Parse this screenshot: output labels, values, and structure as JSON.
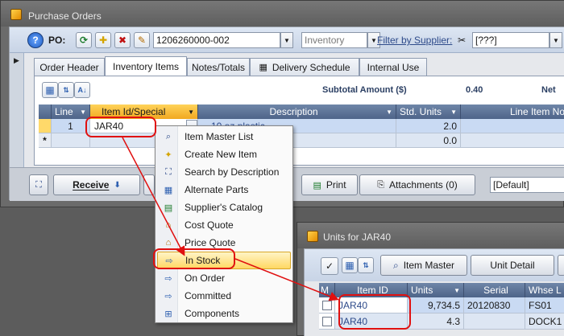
{
  "po_window": {
    "title": "Purchase Orders",
    "po_label": "PO:",
    "po_number": "1206260000-002",
    "type_value": "Inventory",
    "filter_label": "Filter by Supplier:",
    "filter_value": "[???]",
    "help_glyph": "?"
  },
  "tabs": [
    {
      "label": "Order Header"
    },
    {
      "label": "Inventory Items"
    },
    {
      "label": "Notes/Totals"
    },
    {
      "label": "Delivery Schedule"
    },
    {
      "label": "Internal Use"
    }
  ],
  "subtotal": {
    "label": "Subtotal Amount ($)",
    "value": "0.40",
    "net_label": "Net"
  },
  "grid": {
    "columns": [
      "Line",
      "Item Id/Special",
      "Description",
      "Std. Units",
      "Line Item No"
    ],
    "rows": [
      {
        "line": "1",
        "item_id": "JAR40",
        "description": "10 oz plastic",
        "std_units": "2.0"
      },
      {
        "marker": "*",
        "line": "",
        "item_id": "",
        "description": "",
        "std_units": "0.0"
      }
    ]
  },
  "buttons": {
    "receive": "Receive",
    "print": "Print",
    "attachments": "Attachments (0)",
    "default_value": "[Default]"
  },
  "context_menu": {
    "items": [
      {
        "label": "Item Master List",
        "icon": "magnifier-doc-icon"
      },
      {
        "label": "Create New Item",
        "icon": "new-item-icon"
      },
      {
        "label": "Search by Description",
        "icon": "binoculars-icon"
      },
      {
        "label": "Alternate Parts",
        "icon": "alt-parts-icon"
      },
      {
        "label": "Supplier's Catalog",
        "icon": "catalog-icon"
      },
      {
        "label": "Cost Quote",
        "icon": "cost-quote-icon"
      },
      {
        "label": "Price Quote",
        "icon": "price-quote-icon"
      },
      {
        "label": "In Stock",
        "icon": "in-stock-icon",
        "highlighted": true
      },
      {
        "label": "On Order",
        "icon": "on-order-icon"
      },
      {
        "label": "Committed",
        "icon": "committed-icon"
      },
      {
        "label": "Components",
        "icon": "components-icon"
      }
    ]
  },
  "units_window": {
    "title": "Units for JAR40",
    "item_master_button": "Item Master",
    "unit_detail_button": "Unit Detail",
    "columns": [
      "M",
      "Item ID",
      "Units",
      "Serial",
      "Whse L"
    ],
    "rows": [
      {
        "item_id": "JAR40",
        "units": "9,734.5",
        "serial": "20120830",
        "whse": "FS01"
      },
      {
        "item_id": "JAR40",
        "units": "4.3",
        "serial": "",
        "whse": "DOCK1"
      }
    ]
  },
  "colors": {
    "accent_orange": "#f1a820",
    "annotation_red": "#e01010",
    "header_blue": "#5a7096",
    "link_blue": "#2d4a8a"
  }
}
